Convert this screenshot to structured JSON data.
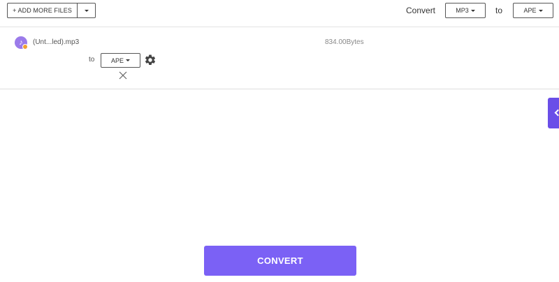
{
  "toolbar": {
    "add_more_files_label": "+ ADD MORE FILES",
    "convert_label": "Convert",
    "from_format": "MP3",
    "to_label": "to",
    "to_format": "APE"
  },
  "file": {
    "name": "(Unt...led).mp3",
    "size": "834.00Bytes",
    "to_label": "to",
    "target_format": "APE",
    "icon": "music-note-icon"
  },
  "actions": {
    "convert_label": "CONVERT"
  },
  "colors": {
    "accent": "#7b61f5",
    "side_tab": "#6a4ee8",
    "file_icon": "#9b7bea"
  }
}
